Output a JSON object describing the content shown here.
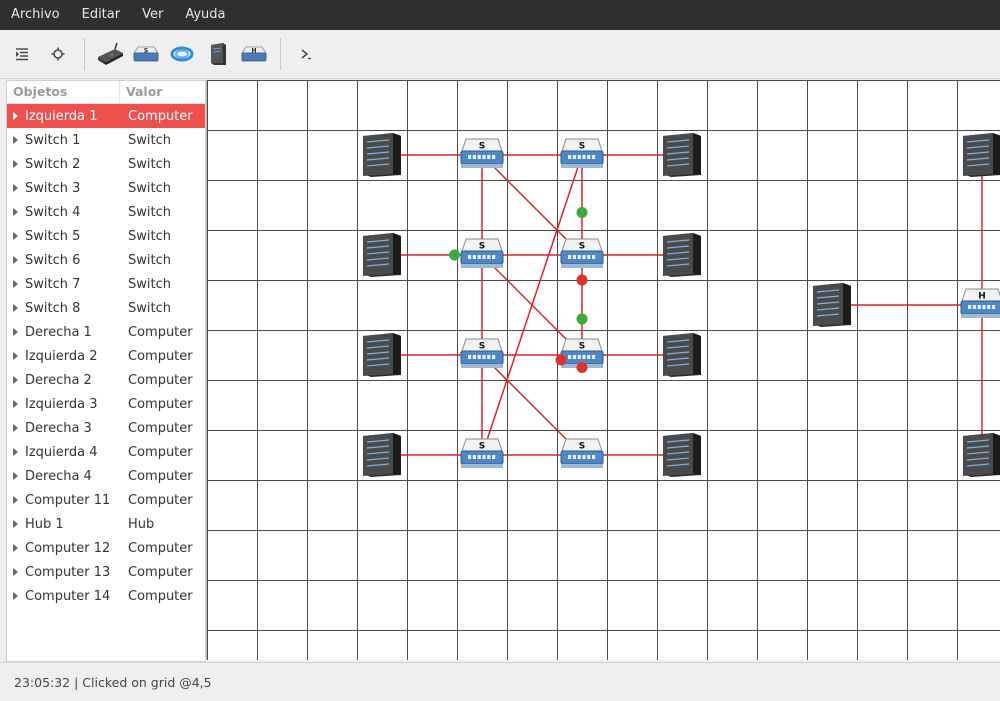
{
  "menubar": {
    "items": [
      "Archivo",
      "Editar",
      "Ver",
      "Ayuda"
    ]
  },
  "toolbar": {
    "buttons": [
      "list-indent-icon",
      "settings-icon",
      "router-icon",
      "switch-icon",
      "cable-icon",
      "server-icon",
      "hub-icon",
      "terminal-icon"
    ]
  },
  "object_panel": {
    "col_objects": "Objetos",
    "col_value": "Valor",
    "rows": [
      {
        "name": "Izquierda 1",
        "value": "Computer",
        "selected": true
      },
      {
        "name": "Switch 1",
        "value": "Switch"
      },
      {
        "name": "Switch 2",
        "value": "Switch"
      },
      {
        "name": "Switch 3",
        "value": "Switch"
      },
      {
        "name": "Switch 4",
        "value": "Switch"
      },
      {
        "name": "Switch 5",
        "value": "Switch"
      },
      {
        "name": "Switch 6",
        "value": "Switch"
      },
      {
        "name": "Switch 7",
        "value": "Switch"
      },
      {
        "name": "Switch 8",
        "value": "Switch"
      },
      {
        "name": "Derecha 1",
        "value": "Computer"
      },
      {
        "name": "Izquierda 2",
        "value": "Computer"
      },
      {
        "name": "Derecha 2",
        "value": "Computer"
      },
      {
        "name": "Izquierda 3",
        "value": "Computer"
      },
      {
        "name": "Derecha 3",
        "value": "Computer"
      },
      {
        "name": "Izquierda 4",
        "value": "Computer"
      },
      {
        "name": "Derecha 4",
        "value": "Computer"
      },
      {
        "name": "Computer 11",
        "value": "Computer"
      },
      {
        "name": "Hub 1",
        "value": "Hub"
      },
      {
        "name": "Computer 12",
        "value": "Computer"
      },
      {
        "name": "Computer 13",
        "value": "Computer"
      },
      {
        "name": "Computer 14",
        "value": "Computer"
      }
    ]
  },
  "canvas": {
    "grid_cell": 50,
    "colors": {
      "grid": "#4a4a4a",
      "link": "#e02020",
      "ok": "#3aaa3a",
      "err": "#e03030"
    },
    "devices": [
      {
        "id": "izq1",
        "type": "computer",
        "cell": [
          3,
          1
        ]
      },
      {
        "id": "sw1",
        "type": "switch",
        "label": "S",
        "cell": [
          5,
          1
        ]
      },
      {
        "id": "sw2",
        "type": "switch",
        "label": "S",
        "cell": [
          7,
          1
        ]
      },
      {
        "id": "der1",
        "type": "computer",
        "cell": [
          9,
          1
        ]
      },
      {
        "id": "izq2",
        "type": "computer",
        "cell": [
          3,
          3
        ]
      },
      {
        "id": "sw3",
        "type": "switch",
        "label": "S",
        "cell": [
          5,
          3
        ]
      },
      {
        "id": "sw4",
        "type": "switch",
        "label": "S",
        "cell": [
          7,
          3
        ]
      },
      {
        "id": "der2",
        "type": "computer",
        "cell": [
          9,
          3
        ]
      },
      {
        "id": "izq3",
        "type": "computer",
        "cell": [
          3,
          5
        ]
      },
      {
        "id": "sw5",
        "type": "switch",
        "label": "S",
        "cell": [
          5,
          5
        ]
      },
      {
        "id": "sw6",
        "type": "switch",
        "label": "S",
        "cell": [
          7,
          5
        ]
      },
      {
        "id": "der3",
        "type": "computer",
        "cell": [
          9,
          5
        ]
      },
      {
        "id": "izq4",
        "type": "computer",
        "cell": [
          3,
          7
        ]
      },
      {
        "id": "sw7",
        "type": "switch",
        "label": "S",
        "cell": [
          5,
          7
        ]
      },
      {
        "id": "sw8",
        "type": "switch",
        "label": "S",
        "cell": [
          7,
          7
        ]
      },
      {
        "id": "der4",
        "type": "computer",
        "cell": [
          9,
          7
        ]
      },
      {
        "id": "c11",
        "type": "computer",
        "cell": [
          12,
          4
        ]
      },
      {
        "id": "hub1",
        "type": "hub",
        "label": "H",
        "cell": [
          15,
          4
        ]
      },
      {
        "id": "c12",
        "type": "computer",
        "cell": [
          15,
          1
        ]
      },
      {
        "id": "c14",
        "type": "computer",
        "cell": [
          15,
          7
        ]
      }
    ],
    "links": [
      [
        "izq1",
        "sw1"
      ],
      [
        "sw1",
        "sw2"
      ],
      [
        "sw2",
        "der1"
      ],
      [
        "izq2",
        "sw3"
      ],
      [
        "sw3",
        "sw4"
      ],
      [
        "sw4",
        "der2"
      ],
      [
        "izq3",
        "sw5"
      ],
      [
        "sw5",
        "sw6"
      ],
      [
        "sw6",
        "der3"
      ],
      [
        "izq4",
        "sw7"
      ],
      [
        "sw7",
        "sw8"
      ],
      [
        "sw8",
        "der4"
      ],
      [
        "sw1",
        "sw3"
      ],
      [
        "sw3",
        "sw5"
      ],
      [
        "sw5",
        "sw7"
      ],
      [
        "sw2",
        "sw4"
      ],
      [
        "sw4",
        "sw6"
      ],
      [
        "sw1",
        "sw4"
      ],
      [
        "sw3",
        "sw6"
      ],
      [
        "sw5",
        "sw8"
      ],
      [
        "sw2",
        "sw7"
      ],
      [
        "c11",
        "hub1"
      ],
      [
        "hub1",
        "c12"
      ],
      [
        "hub1",
        "c14"
      ]
    ],
    "markers": [
      {
        "cell": [
          4.45,
          3
        ],
        "state": "ok"
      },
      {
        "cell": [
          7,
          2.15
        ],
        "state": "ok"
      },
      {
        "cell": [
          7,
          3.5
        ],
        "state": "err"
      },
      {
        "cell": [
          7,
          4.28
        ],
        "state": "ok"
      },
      {
        "cell": [
          6.58,
          5.1
        ],
        "state": "err"
      },
      {
        "cell": [
          7,
          5.25
        ],
        "state": "err"
      }
    ]
  },
  "statusbar": {
    "text": "23:05:32 | Clicked on grid @4,5"
  }
}
